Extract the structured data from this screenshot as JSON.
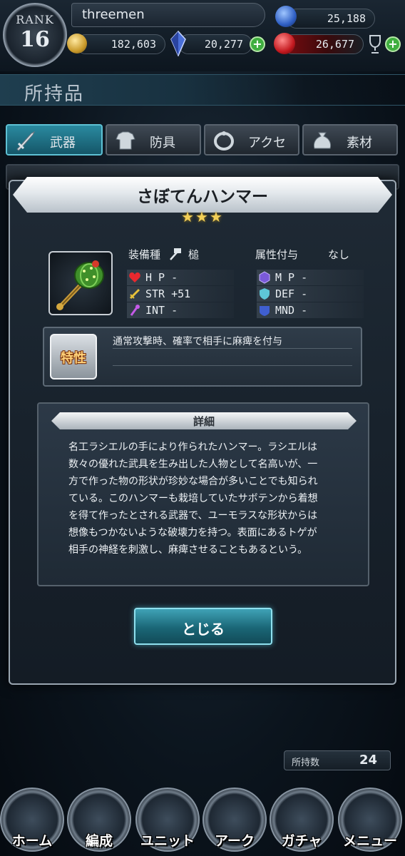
{
  "status": {
    "rank_label": "RANK",
    "rank_value": "16",
    "player_name": "threemen",
    "stat_top_right": "25,188",
    "gold": "182,603",
    "crystals": "20,277",
    "red_currency": "26,677"
  },
  "section": {
    "title": "所持品"
  },
  "tabs": [
    {
      "label": "武器",
      "icon": "sword-icon",
      "active": true
    },
    {
      "label": "防具",
      "icon": "armor-icon",
      "active": false
    },
    {
      "label": "アクセ",
      "icon": "ring-icon",
      "active": false
    },
    {
      "label": "素材",
      "icon": "bag-icon",
      "active": false
    }
  ],
  "item": {
    "name": "さぼてんハンマー",
    "stars": "★★★",
    "equip_type_label": "装備種",
    "equip_type_value": "槌",
    "element_label": "属性付与",
    "element_value": "なし",
    "stats": {
      "hp": "H P -",
      "mp": "M P -",
      "str": "STR +51",
      "def": "DEF -",
      "int": "INT -",
      "mnd": "MND -"
    },
    "trait_label": "特性",
    "trait_text": "通常攻撃時、確率で相手に麻痺を付与",
    "detail_label": "詳細",
    "detail_lines": [
      "名工ラシエルの手により作られたハンマー。ラシエルは",
      "数々の優れた武具を生み出した人物として名高いが、一",
      "方で作った物の形状が珍妙な場合が多いことでも知られ",
      "ている。このハンマーも栽培していたサボテンから着想",
      "を得て作ったとされる武器で、ユーモラスな形状からは",
      "想像もつかないような破壊力を持つ。表面にあるトゲが",
      "相手の神経を刺激し、麻痺させることもあるという。"
    ],
    "close_label": "とじる"
  },
  "inventory": {
    "count_label": "所持数",
    "count_value": "24"
  },
  "nav": [
    {
      "label": "ホーム",
      "icon": "home-icon"
    },
    {
      "label": "編成",
      "icon": "party-icon"
    },
    {
      "label": "ユニット",
      "icon": "unit-icon"
    },
    {
      "label": "アーク",
      "icon": "ark-icon"
    },
    {
      "label": "ガチャ",
      "icon": "gacha-crystal-icon"
    },
    {
      "label": "メニュー",
      "icon": "menu-scroll-icon"
    }
  ],
  "colors": {
    "accent_teal": "#2a8aa0",
    "star_gold": "#f2cf57",
    "plus_green": "#3fae3f"
  }
}
